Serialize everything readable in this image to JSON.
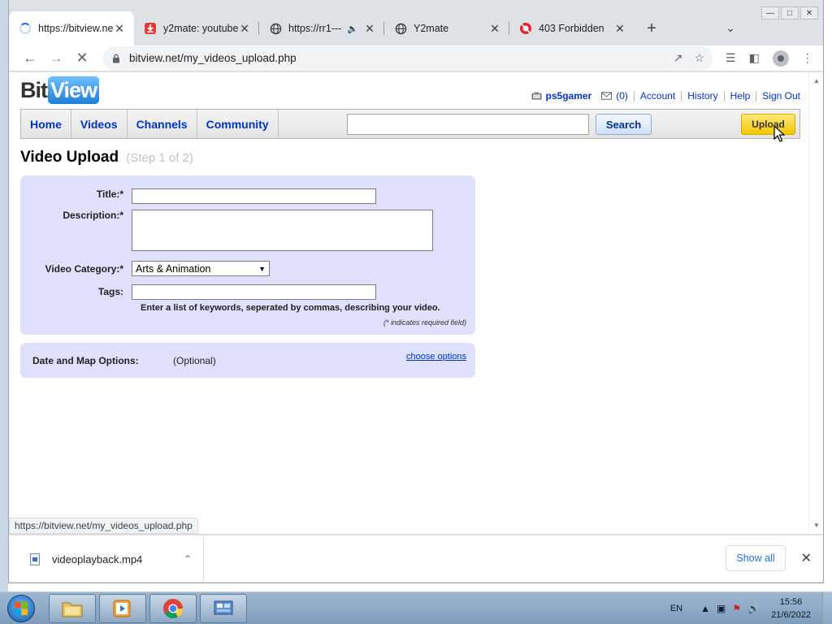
{
  "browser": {
    "tabs": [
      {
        "title": "https://bitview.ne",
        "active": true,
        "favicon": "loading-spinner"
      },
      {
        "title": "y2mate: youtube",
        "active": false,
        "favicon": "y2mate-download-icon"
      },
      {
        "title": "https://rr1---",
        "active": false,
        "favicon": "globe-icon",
        "audio": true
      },
      {
        "title": "Y2mate",
        "active": false,
        "favicon": "globe-icon"
      },
      {
        "title": "403 Forbidden",
        "active": false,
        "favicon": "opera-red-icon"
      }
    ],
    "address": "bitview.net/my_videos_upload.php",
    "status_url": "https://bitview.net/my_videos_upload.php"
  },
  "site": {
    "logo": {
      "part1": "Bit",
      "part2": "View"
    },
    "user": {
      "username": "ps5gamer",
      "inbox_count": "(0)",
      "links": [
        "Account",
        "History",
        "Help",
        "Sign Out"
      ]
    },
    "nav": [
      "Home",
      "Videos",
      "Channels",
      "Community"
    ],
    "search": {
      "value": "",
      "button": "Search"
    },
    "upload_button": "Upload"
  },
  "page": {
    "title": "Video Upload",
    "step": "(Step 1 of 2)",
    "form": {
      "title_label": "Title:*",
      "title_value": "",
      "description_label": "Description:*",
      "description_value": "",
      "category_label": "Video Category:*",
      "category_value": "Arts & Animation",
      "tags_label": "Tags:",
      "tags_value": "",
      "tags_hint": "Enter a list of keywords, seperated by commas, describing your video.",
      "required_note": "(* indicates required field)"
    },
    "options": {
      "label": "Date and Map Options:",
      "optional": "(Optional)",
      "link": "choose options"
    }
  },
  "downloads": {
    "file": "videoplayback.mp4",
    "show_all": "Show all"
  },
  "taskbar": {
    "language": "EN",
    "time": "15:56",
    "date": "21/6/2022"
  },
  "colors": {
    "form_bg": "#dfe0fb",
    "link": "#0033cc",
    "upload_btn": "#f4c600",
    "chrome_blue": "#1a73e8"
  }
}
